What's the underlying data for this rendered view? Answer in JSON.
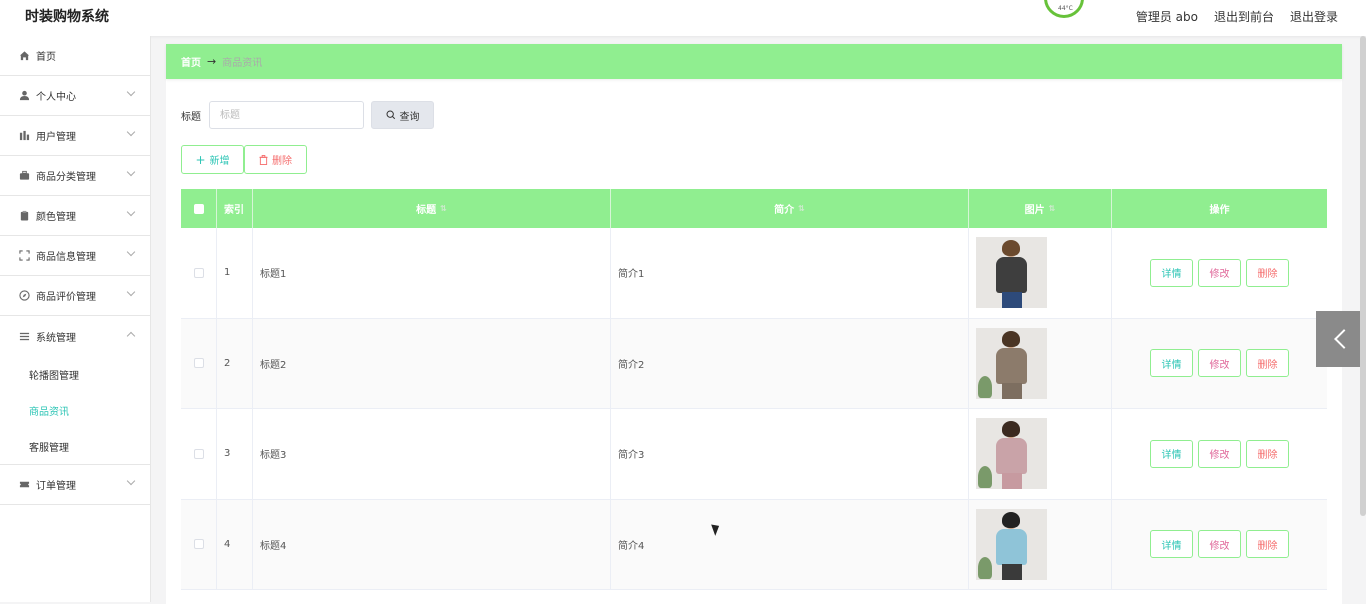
{
  "header": {
    "app_title": "时装购物系统",
    "weather_temp": "44°C",
    "admin_label": "管理员 abo",
    "back_to_front": "退出到前台",
    "logout": "退出登录"
  },
  "sidebar": {
    "items": [
      {
        "label": "首页",
        "icon": "home-icon"
      },
      {
        "label": "个人中心",
        "icon": "user-icon"
      },
      {
        "label": "用户管理",
        "icon": "bar-chart-icon"
      },
      {
        "label": "商品分类管理",
        "icon": "briefcase-icon"
      },
      {
        "label": "颜色管理",
        "icon": "clipboard-icon"
      },
      {
        "label": "商品信息管理",
        "icon": "fullscreen-icon"
      },
      {
        "label": "商品评价管理",
        "icon": "compass-icon"
      },
      {
        "label": "系统管理",
        "icon": "menu-icon"
      },
      {
        "label": "订单管理",
        "icon": "ticket-icon"
      }
    ],
    "system_sub": [
      {
        "label": "轮播图管理"
      },
      {
        "label": "商品资讯"
      },
      {
        "label": "客服管理"
      }
    ]
  },
  "breadcrumb": {
    "home": "首页",
    "arrow": "→",
    "current": "商品资讯"
  },
  "search": {
    "label": "标题",
    "placeholder": "标题",
    "button": "查询"
  },
  "actions": {
    "add": "新增",
    "delete": "删除"
  },
  "table": {
    "headers": {
      "index": "索引",
      "title": "标题",
      "intro": "简介",
      "image": "图片",
      "ops": "操作"
    },
    "rows": [
      {
        "index": "1",
        "title": "标题1",
        "intro": "简介1"
      },
      {
        "index": "2",
        "title": "标题2",
        "intro": "简介2"
      },
      {
        "index": "3",
        "title": "标题3",
        "intro": "简介3"
      },
      {
        "index": "4",
        "title": "标题4",
        "intro": "简介4"
      }
    ],
    "ops": {
      "detail": "详情",
      "edit": "修改",
      "delete": "删除"
    }
  },
  "colors": {
    "accent_green": "#90ee90",
    "teal": "#2cc5b5",
    "danger": "#f56c6c",
    "pink": "#e0689a"
  }
}
